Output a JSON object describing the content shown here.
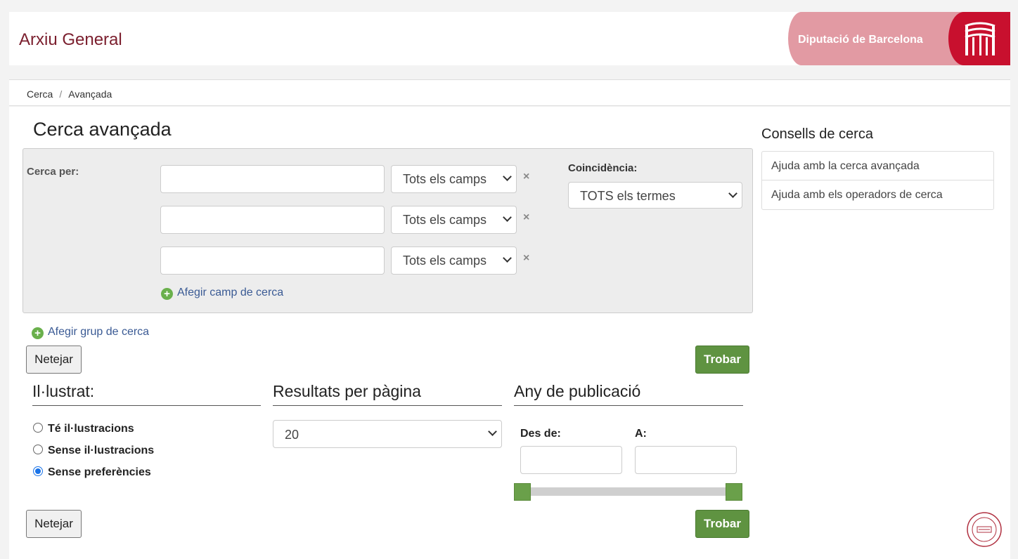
{
  "header": {
    "app_title": "Arxiu General",
    "brand_name": "Diputació de Barcelona"
  },
  "breadcrumb": {
    "items": [
      "Cerca",
      "Avançada"
    ],
    "separator": "/"
  },
  "page": {
    "title": "Cerca avançada"
  },
  "search_group": {
    "search_by_label": "Cerca per:",
    "rows": [
      {
        "value": "",
        "field": "Tots els camps"
      },
      {
        "value": "",
        "field": "Tots els camps"
      },
      {
        "value": "",
        "field": "Tots els camps"
      }
    ],
    "remove_symbol": "×",
    "match_label": "Coincidència:",
    "match_value": "TOTS els termes",
    "add_field_label": "Afegir camp de cerca"
  },
  "add_group_label": "Afegir grup de cerca",
  "buttons": {
    "clear": "Netejar",
    "find": "Trobar"
  },
  "facets": {
    "illustrated": {
      "title": "Il·lustrat:",
      "options": [
        "Té il·lustracions",
        "Sense il·lustracions",
        "Sense preferències"
      ],
      "selected_index": 2
    },
    "results_per_page": {
      "title": "Resultats per pàgina",
      "value": "20"
    },
    "publication_year": {
      "title": "Any de publicació",
      "from_label": "Des de:",
      "to_label": "A:",
      "from_value": "",
      "to_value": "",
      "slider_range": [
        0,
        1
      ]
    }
  },
  "sidebar": {
    "title": "Consells de cerca",
    "items": [
      "Ajuda amb la cerca avançada",
      "Ajuda amb els operadors de cerca"
    ]
  },
  "colors": {
    "brand_dark": "#7b1f2e",
    "brand_pink": "#e29aa3",
    "brand_red": "#c8102e",
    "action_green": "#5f9341",
    "link_blue": "#3a5a94"
  }
}
